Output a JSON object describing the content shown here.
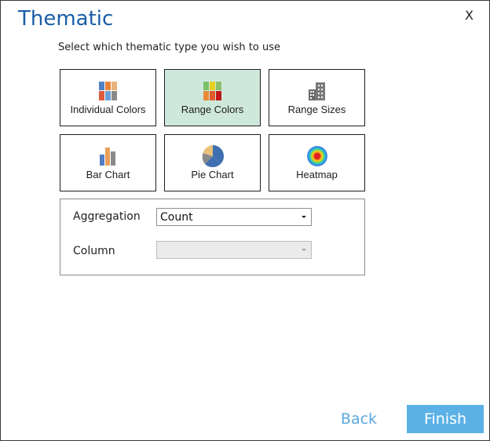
{
  "dialog": {
    "title": "Thematic",
    "close_label": "X",
    "subtitle": "Select which thematic type you wish to use"
  },
  "thematic_types": [
    {
      "label": "Individual Colors",
      "icon": "individual-colors-icon",
      "selected": false
    },
    {
      "label": "Range Colors",
      "icon": "range-colors-icon",
      "selected": true
    },
    {
      "label": "Range Sizes",
      "icon": "range-sizes-icon",
      "selected": false
    },
    {
      "label": "Bar Chart",
      "icon": "bar-chart-icon",
      "selected": false
    },
    {
      "label": "Pie Chart",
      "icon": "pie-chart-icon",
      "selected": false
    },
    {
      "label": "Heatmap",
      "icon": "heatmap-icon",
      "selected": false
    }
  ],
  "settings": {
    "aggregation_label": "Aggregation",
    "aggregation_value": "Count",
    "column_label": "Column",
    "column_value": ""
  },
  "footer": {
    "back_label": "Back",
    "finish_label": "Finish"
  },
  "colors": {
    "title": "#1a5ea8",
    "selected_tile": "#cfe8dc",
    "finish_button": "#5bb1e6",
    "back_link": "#5aa8dc"
  }
}
